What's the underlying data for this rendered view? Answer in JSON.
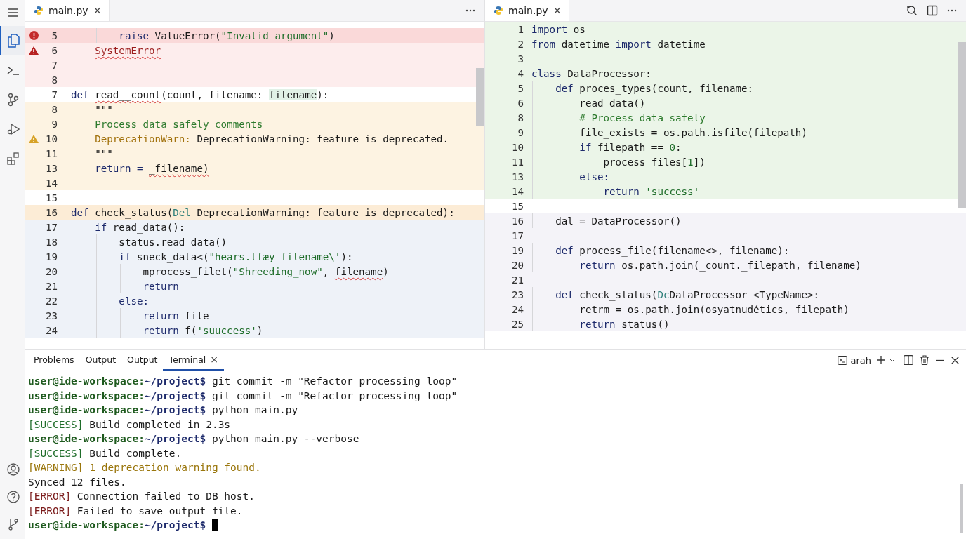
{
  "activity_bar": {
    "top": [
      {
        "kind": "menu",
        "selected": false
      },
      {
        "kind": "files",
        "selected": true
      },
      {
        "kind": "terminal",
        "selected": false
      },
      {
        "kind": "source",
        "selected": false
      },
      {
        "kind": "debug",
        "selected": false
      },
      {
        "kind": "extensions",
        "selected": false
      }
    ],
    "bottom": [
      {
        "kind": "account",
        "selected": false
      },
      {
        "kind": "help",
        "selected": false
      },
      {
        "kind": "branch",
        "selected": false
      }
    ]
  },
  "editors": [
    {
      "tab": {
        "title": "main.py",
        "close": "×"
      },
      "actions": [
        {
          "kind": "more"
        }
      ],
      "lines": [
        {
          "num": "5",
          "kind": "error-strong",
          "marker": {
            "kind": "error"
          },
          "segs": [
            {
              "text": "        raise ",
              "kind": "kw"
            },
            {
              "text": "ValueError(",
              "kind": "plain"
            },
            {
              "text": "\"Invalid argument\"",
              "kind": "str"
            },
            {
              "text": ")",
              "kind": "plain"
            }
          ]
        },
        {
          "num": "6",
          "kind": "error",
          "marker": {
            "kind": "warning-red"
          },
          "segs": [
            {
              "text": "    SystemError",
              "kind": "error-squiggle"
            }
          ]
        },
        {
          "num": "7",
          "kind": "error"
        },
        {
          "num": "8",
          "kind": "error"
        },
        {
          "num": "7",
          "kind": "plain",
          "segs": [
            {
              "text": "def ",
              "kind": "kw"
            },
            {
              "text": "read__count",
              "kind": "squiggle"
            },
            {
              "text": "(count, filename: ",
              "kind": "plain"
            },
            {
              "text": "filename",
              "kind": "highlight"
            },
            {
              "text": "):",
              "kind": "plain"
            }
          ]
        },
        {
          "num": "8",
          "kind": "warn",
          "segs": [
            {
              "text": "    \"\"\"",
              "kind": "plain"
            }
          ]
        },
        {
          "num": "9",
          "kind": "warn",
          "segs": [
            {
              "text": "    Process data safely comments",
              "kind": "comment"
            }
          ]
        },
        {
          "num": "10",
          "kind": "warn",
          "marker": {
            "kind": "warning"
          },
          "segs": [
            {
              "text": "    DeprecationWarn:",
              "kind": "warn"
            },
            {
              "text": " DeprecationWarning: feature is deprecated.",
              "kind": "plain"
            }
          ]
        },
        {
          "num": "11",
          "kind": "warn",
          "segs": [
            {
              "text": "    \"\"\"",
              "kind": "plain"
            }
          ]
        },
        {
          "num": "13",
          "kind": "warn",
          "segs": [
            {
              "text": "    return = ",
              "kind": "kw"
            },
            {
              "text": "_filename)",
              "kind": "squiggle"
            }
          ]
        },
        {
          "num": "14",
          "kind": "warn"
        },
        {
          "num": "15",
          "kind": "plain"
        },
        {
          "num": "16",
          "kind": "warn-strong",
          "segs": [
            {
              "text": "def ",
              "kind": "kw"
            },
            {
              "text": "check_status(",
              "kind": "plain"
            },
            {
              "text": "Del",
              "kind": "teal"
            },
            {
              "text": " DeprecationWarning: feature is deprecated):",
              "kind": "plain"
            }
          ]
        },
        {
          "num": "17",
          "kind": "blue",
          "segs": [
            {
              "text": "    if ",
              "kind": "kw"
            },
            {
              "text": "read_data():",
              "kind": "plain"
            }
          ]
        },
        {
          "num": "18",
          "kind": "blue",
          "segs": [
            {
              "text": "        status.read_data()",
              "kind": "plain"
            }
          ]
        },
        {
          "num": "19",
          "kind": "blue",
          "segs": [
            {
              "text": "        if ",
              "kind": "kw"
            },
            {
              "text": "sneck_data<(",
              "kind": "plain"
            },
            {
              "text": "\"hears.tfæy filename\\'",
              "kind": "str"
            },
            {
              "text": "):",
              "kind": "plain"
            }
          ]
        },
        {
          "num": "20",
          "kind": "blue",
          "segs": [
            {
              "text": "            mprocess_filet(",
              "kind": "plain"
            },
            {
              "text": "\"Shreeding_now\"",
              "kind": "str"
            },
            {
              "text": ", ",
              "kind": "plain"
            },
            {
              "text": "filename",
              "kind": "squiggle"
            },
            {
              "text": ")",
              "kind": "plain"
            }
          ]
        },
        {
          "num": "21",
          "kind": "blue",
          "segs": [
            {
              "text": "            return",
              "kind": "kw"
            }
          ]
        },
        {
          "num": "22",
          "kind": "blue",
          "segs": [
            {
              "text": "        else:",
              "kind": "kw"
            }
          ]
        },
        {
          "num": "23",
          "kind": "blue",
          "segs": [
            {
              "text": "            return ",
              "kind": "kw"
            },
            {
              "text": "file",
              "kind": "plain"
            }
          ]
        },
        {
          "num": "24",
          "kind": "blue",
          "segs": [
            {
              "text": "            return ",
              "kind": "kw"
            },
            {
              "text": "f(",
              "kind": "plain"
            },
            {
              "text": "'suuccess'",
              "kind": "str"
            },
            {
              "text": ")",
              "kind": "plain"
            }
          ]
        }
      ]
    },
    {
      "tab": {
        "title": "main.py",
        "close": "×"
      },
      "actions": [
        {
          "kind": "search"
        },
        {
          "kind": "split"
        },
        {
          "kind": "more"
        }
      ],
      "lines": [
        {
          "num": "1",
          "kind": "green",
          "segs": [
            {
              "text": "import ",
              "kind": "kw"
            },
            {
              "text": "os",
              "kind": "plain"
            }
          ]
        },
        {
          "num": "2",
          "kind": "green",
          "segs": [
            {
              "text": "from ",
              "kind": "kw"
            },
            {
              "text": "datetime ",
              "kind": "plain"
            },
            {
              "text": "import ",
              "kind": "kw"
            },
            {
              "text": "datetime",
              "kind": "plain"
            }
          ]
        },
        {
          "num": "3",
          "kind": "green"
        },
        {
          "num": "4",
          "kind": "green",
          "segs": [
            {
              "text": "class ",
              "kind": "kw"
            },
            {
              "text": "DataProcessor:",
              "kind": "plain"
            }
          ]
        },
        {
          "num": "5",
          "kind": "green",
          "segs": [
            {
              "text": "    def ",
              "kind": "kw"
            },
            {
              "text": "proces_types(count, filename:",
              "kind": "plain"
            }
          ]
        },
        {
          "num": "6",
          "kind": "green",
          "segs": [
            {
              "text": "        read_data()",
              "kind": "plain"
            }
          ]
        },
        {
          "num": "8",
          "kind": "green",
          "segs": [
            {
              "text": "        # Process data safely",
              "kind": "comment"
            }
          ]
        },
        {
          "num": "9",
          "kind": "green",
          "segs": [
            {
              "text": "        file_exists = os.path.isfile(filepath)",
              "kind": "plain"
            }
          ]
        },
        {
          "num": "10",
          "kind": "green",
          "segs": [
            {
              "text": "        if ",
              "kind": "kw"
            },
            {
              "text": "filepath == ",
              "kind": "plain"
            },
            {
              "text": "0",
              "kind": "str"
            },
            {
              "text": ":",
              "kind": "plain"
            }
          ]
        },
        {
          "num": "11",
          "kind": "green",
          "segs": [
            {
              "text": "            process_files[",
              "kind": "plain"
            },
            {
              "text": "1",
              "kind": "str"
            },
            {
              "text": "])",
              "kind": "plain"
            }
          ]
        },
        {
          "num": "13",
          "kind": "green",
          "segs": [
            {
              "text": "        else:",
              "kind": "kw"
            }
          ]
        },
        {
          "num": "14",
          "kind": "green",
          "segs": [
            {
              "text": "            return ",
              "kind": "kw"
            },
            {
              "text": "'success'",
              "kind": "str"
            }
          ]
        },
        {
          "num": "15",
          "kind": "plain"
        },
        {
          "num": "16",
          "kind": "purple",
          "segs": [
            {
              "text": "    dal = DataProcessor()",
              "kind": "plain"
            }
          ]
        },
        {
          "num": "17",
          "kind": "purple"
        },
        {
          "num": "19",
          "kind": "purple",
          "segs": [
            {
              "text": "    def ",
              "kind": "kw"
            },
            {
              "text": "process_file(filename<>, filename):",
              "kind": "plain"
            }
          ]
        },
        {
          "num": "20",
          "kind": "purple",
          "segs": [
            {
              "text": "        return ",
              "kind": "kw"
            },
            {
              "text": "os.path.join(_count._filepath, filename)",
              "kind": "plain"
            }
          ]
        },
        {
          "num": "21",
          "kind": "purple"
        },
        {
          "num": "23",
          "kind": "purple",
          "segs": [
            {
              "text": "    def ",
              "kind": "kw"
            },
            {
              "text": "check_status(",
              "kind": "plain"
            },
            {
              "text": "Dc",
              "kind": "teal"
            },
            {
              "text": "DataProcessor <TypeName>:",
              "kind": "plain"
            }
          ]
        },
        {
          "num": "24",
          "kind": "purple",
          "segs": [
            {
              "text": "        retrm = os.path.join(osyatnudétics, filepath)",
              "kind": "plain"
            }
          ]
        },
        {
          "num": "25",
          "kind": "purple",
          "segs": [
            {
              "text": "        return ",
              "kind": "kw"
            },
            {
              "text": "status()",
              "kind": "plain"
            }
          ]
        }
      ]
    }
  ],
  "panel": {
    "tabs": [
      {
        "label": "Problems",
        "selected": false
      },
      {
        "label": "Output",
        "selected": false
      },
      {
        "label": "Output",
        "selected": false
      },
      {
        "label": "Terminal",
        "selected": true,
        "close": "×"
      }
    ],
    "shell": "arah",
    "terminal": [
      {
        "segs": [
          {
            "text": "user@ide-workspace:",
            "kind": "user"
          },
          {
            "text": "~/project$",
            "kind": "path"
          },
          {
            "text": " git commit -m \"Refactor processing loop\"",
            "kind": "plain"
          }
        ]
      },
      {
        "segs": [
          {
            "text": "user@ide-workspace:",
            "kind": "user"
          },
          {
            "text": "~/project$",
            "kind": "path"
          },
          {
            "text": " git commit -m \"Refactor processing loop\"",
            "kind": "plain"
          }
        ]
      },
      {
        "segs": [
          {
            "text": "user@ide-workspace:",
            "kind": "user"
          },
          {
            "text": "~/project$",
            "kind": "path"
          },
          {
            "text": " python main.py",
            "kind": "plain"
          }
        ]
      },
      {
        "segs": [
          {
            "text": "[SUCCESS]",
            "kind": "ok"
          },
          {
            "text": " Build completed in 2.3s",
            "kind": "plain"
          }
        ]
      },
      {
        "segs": [
          {
            "text": "user@ide-workspace:",
            "kind": "user"
          },
          {
            "text": "~/project$",
            "kind": "path"
          },
          {
            "text": " python main.py --verbose",
            "kind": "plain"
          }
        ]
      },
      {
        "segs": [
          {
            "text": "[SUCCESS]",
            "kind": "ok"
          },
          {
            "text": " Build complete.",
            "kind": "plain"
          }
        ]
      },
      {
        "segs": [
          {
            "text": "[WARNING] 1 deprecation warning found.",
            "kind": "warn"
          }
        ]
      },
      {
        "segs": [
          {
            "text": "Synced 12 files.",
            "kind": "plain"
          }
        ]
      },
      {
        "segs": [
          {
            "text": "[ERROR]",
            "kind": "err"
          },
          {
            "text": " Connection failed to DB host.",
            "kind": "plain"
          }
        ]
      },
      {
        "segs": [
          {
            "text": "[ERROR]",
            "kind": "err"
          },
          {
            "text": " Failed to save output file.",
            "kind": "plain"
          }
        ]
      },
      {
        "segs": [
          {
            "text": "user@ide-workspace:",
            "kind": "user"
          },
          {
            "text": "~/project$",
            "kind": "path"
          }
        ],
        "cursor": true
      }
    ]
  }
}
